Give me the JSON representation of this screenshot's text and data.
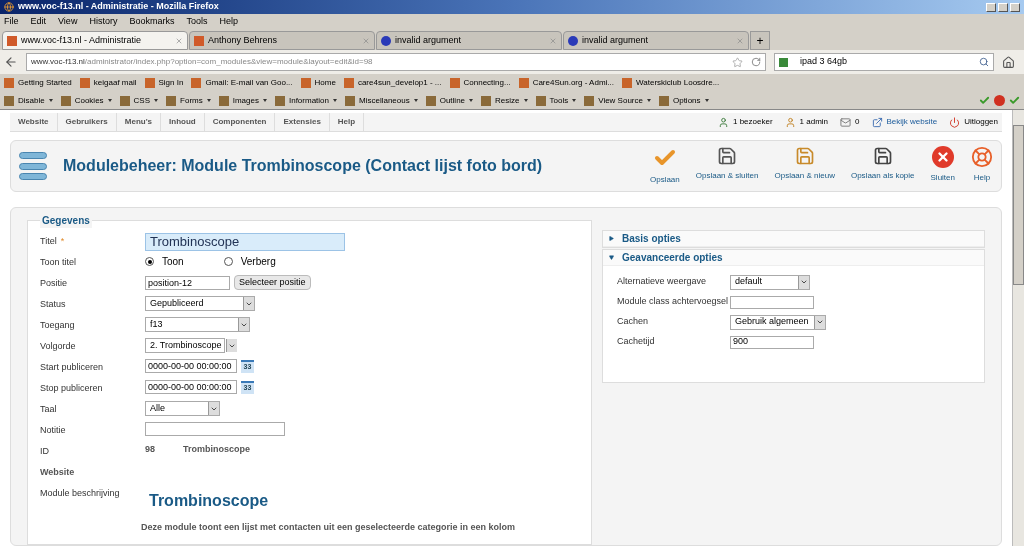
{
  "window": {
    "title": "www.voc-f13.nl - Administratie - Mozilla Firefox"
  },
  "menu_bar": [
    "File",
    "Edit",
    "View",
    "History",
    "Bookmarks",
    "Tools",
    "Help"
  ],
  "tabs": [
    {
      "label": "www.voc-f13.nl - Administratie",
      "selected": true
    },
    {
      "label": "Anthony Behrens",
      "selected": false
    },
    {
      "label": "invalid argument",
      "selected": false
    },
    {
      "label": "invalid argument",
      "selected": false
    }
  ],
  "new_tab": "+",
  "address_bar": {
    "host": "www.voc-f13.nl",
    "path": "/administrator/index.php?option=com_modules&view=module&layout=edit&id=98"
  },
  "search": {
    "value": "ipad 3 64gb"
  },
  "bookmarks": [
    "Getting Started",
    "keigaaf mail",
    "Sign In",
    "Gmail: E-mail van Goo...",
    "Home",
    "care4sun_develop1 - ...",
    "Connecting...",
    "Care4Sun.org - Admi...",
    "Waterskiclub Loosdre..."
  ],
  "dev_toolbar": [
    "Disable",
    "Cookies",
    "CSS",
    "Forms",
    "Images",
    "Information",
    "Miscellaneous",
    "Outline",
    "Resize",
    "Tools",
    "View Source",
    "Options"
  ],
  "admin_menu": [
    "Website",
    "Gebruikers",
    "Menu's",
    "Inhoud",
    "Componenten",
    "Extensies",
    "Help"
  ],
  "status_items": [
    {
      "kind": "visitors",
      "label": "1 bezoeker"
    },
    {
      "kind": "admins",
      "label": "1 admin"
    },
    {
      "kind": "messages",
      "label": "0"
    },
    {
      "kind": "site",
      "label": "Bekijk website"
    },
    {
      "kind": "logout",
      "label": "Uitloggen"
    }
  ],
  "page_title": "Modulebeheer: Module Trombinoscope (Contact lijst foto bord)",
  "toolbar": [
    {
      "kind": "check",
      "label": "Opslaan"
    },
    {
      "kind": "save",
      "label": "Opslaan & sluiten"
    },
    {
      "kind": "save-new",
      "label": "Opslaan & nieuw"
    },
    {
      "kind": "save-copy",
      "label": "Opslaan als kopie"
    },
    {
      "kind": "close",
      "label": "Sluiten"
    },
    {
      "kind": "help",
      "label": "Help"
    }
  ],
  "form": {
    "legend": "Gegevens",
    "fields": [
      {
        "kind": "text",
        "label": "Titel",
        "required_mark": "*",
        "value": "Trombinoscope",
        "focused": true
      },
      {
        "kind": "radio",
        "label": "Toon titel",
        "options": [
          {
            "label": "Toon",
            "selected": true
          },
          {
            "label": "Verberg",
            "selected": false
          }
        ]
      },
      {
        "kind": "text-button",
        "label": "Positie",
        "value": "position-12",
        "button": "Selecteer positie"
      },
      {
        "kind": "select",
        "label": "Status",
        "value": "Gepubliceerd"
      },
      {
        "kind": "select",
        "label": "Toegang",
        "value": "f13"
      },
      {
        "kind": "select",
        "label": "Volgorde",
        "value": "2. Trombinoscope"
      },
      {
        "kind": "date",
        "label": "Start publiceren",
        "value": "0000-00-00 00:00:00",
        "icon_text": "33"
      },
      {
        "kind": "date",
        "label": "Stop publiceren",
        "value": "0000-00-00 00:00:00",
        "icon_text": "33"
      },
      {
        "kind": "select",
        "label": "Taal",
        "value": "Alle"
      },
      {
        "kind": "text",
        "label": "Notitie",
        "focused": false
      },
      {
        "kind": "id",
        "label": "ID",
        "value": "98",
        "name": "Trombinoscope"
      },
      {
        "kind": "label",
        "label": "Website"
      },
      {
        "kind": "description",
        "label": "Module beschrijving",
        "heading": "Trombinoscope",
        "text": "Deze module toont een lijst met contacten uit een geselecteerde categorie in een kolom"
      }
    ]
  },
  "panels": [
    {
      "title": "Basis opties",
      "expanded": false
    },
    {
      "title": "Geavanceerde opties",
      "expanded": true,
      "fields": [
        {
          "kind": "select",
          "label": "Alternatieve weergave",
          "value": "default"
        },
        {
          "kind": "text",
          "label": "Module class achtervoegsel"
        },
        {
          "kind": "select",
          "label": "Cachen",
          "value": "Gebruik algemeen"
        },
        {
          "kind": "text",
          "label": "Cachetijd",
          "value": "900"
        }
      ]
    }
  ]
}
